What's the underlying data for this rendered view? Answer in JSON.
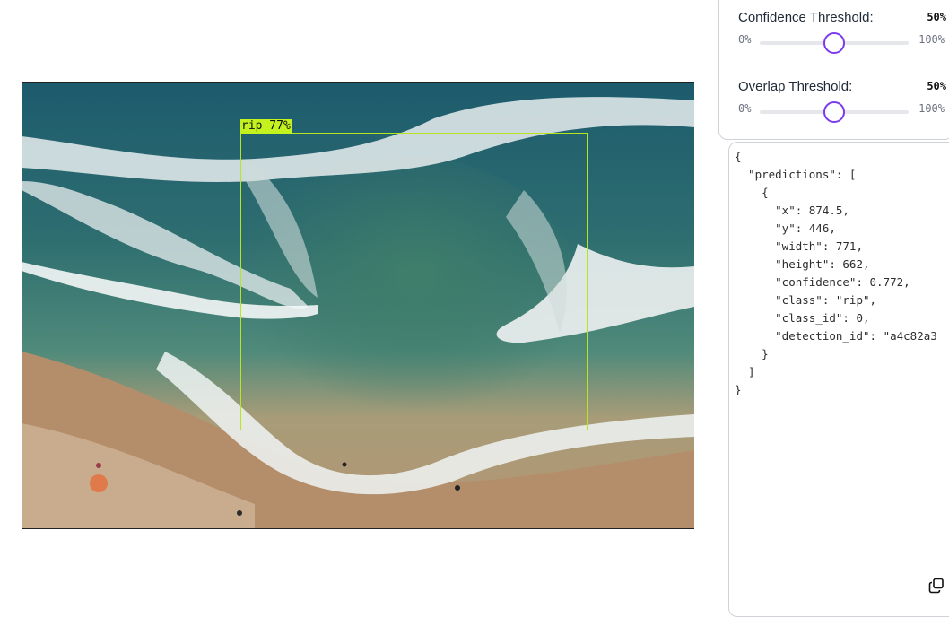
{
  "detection": {
    "label": "rip 77%",
    "box_color": "#b8e61e",
    "label_bg": "#c4f21e"
  },
  "sliders": [
    {
      "title": "Confidence Threshold:",
      "value": "50%",
      "min": "0%",
      "max": "100%",
      "level": 0.5
    },
    {
      "title": "Overlap Threshold:",
      "value": "50%",
      "min": "0%",
      "max": "100%",
      "level": 0.5
    }
  ],
  "accent": "#7c3aed",
  "json_output": {
    "lines": [
      "{",
      "  \"predictions\": [",
      "    {",
      "      \"x\": 874.5,",
      "      \"y\": 446,",
      "      \"width\": 771,",
      "      \"height\": 662,",
      "      \"confidence\": 0.772,",
      "      \"class\": \"rip\",",
      "      \"class_id\": 0,",
      "      \"detection_id\": \"a4c82a3",
      "    }",
      "  ]",
      "}"
    ]
  },
  "icons": {
    "copy": "copy-icon"
  }
}
